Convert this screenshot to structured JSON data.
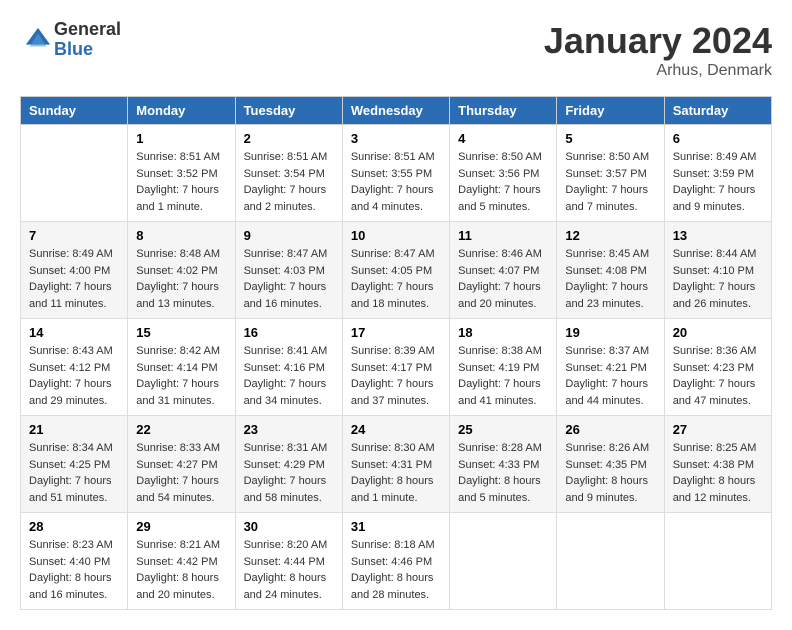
{
  "header": {
    "logo_general": "General",
    "logo_blue": "Blue",
    "month_title": "January 2024",
    "city": "Arhus, Denmark"
  },
  "days_of_week": [
    "Sunday",
    "Monday",
    "Tuesday",
    "Wednesday",
    "Thursday",
    "Friday",
    "Saturday"
  ],
  "weeks": [
    [
      {
        "day": "",
        "sunrise": "",
        "sunset": "",
        "daylight": ""
      },
      {
        "day": "1",
        "sunrise": "Sunrise: 8:51 AM",
        "sunset": "Sunset: 3:52 PM",
        "daylight": "Daylight: 7 hours and 1 minute."
      },
      {
        "day": "2",
        "sunrise": "Sunrise: 8:51 AM",
        "sunset": "Sunset: 3:54 PM",
        "daylight": "Daylight: 7 hours and 2 minutes."
      },
      {
        "day": "3",
        "sunrise": "Sunrise: 8:51 AM",
        "sunset": "Sunset: 3:55 PM",
        "daylight": "Daylight: 7 hours and 4 minutes."
      },
      {
        "day": "4",
        "sunrise": "Sunrise: 8:50 AM",
        "sunset": "Sunset: 3:56 PM",
        "daylight": "Daylight: 7 hours and 5 minutes."
      },
      {
        "day": "5",
        "sunrise": "Sunrise: 8:50 AM",
        "sunset": "Sunset: 3:57 PM",
        "daylight": "Daylight: 7 hours and 7 minutes."
      },
      {
        "day": "6",
        "sunrise": "Sunrise: 8:49 AM",
        "sunset": "Sunset: 3:59 PM",
        "daylight": "Daylight: 7 hours and 9 minutes."
      }
    ],
    [
      {
        "day": "7",
        "sunrise": "Sunrise: 8:49 AM",
        "sunset": "Sunset: 4:00 PM",
        "daylight": "Daylight: 7 hours and 11 minutes."
      },
      {
        "day": "8",
        "sunrise": "Sunrise: 8:48 AM",
        "sunset": "Sunset: 4:02 PM",
        "daylight": "Daylight: 7 hours and 13 minutes."
      },
      {
        "day": "9",
        "sunrise": "Sunrise: 8:47 AM",
        "sunset": "Sunset: 4:03 PM",
        "daylight": "Daylight: 7 hours and 16 minutes."
      },
      {
        "day": "10",
        "sunrise": "Sunrise: 8:47 AM",
        "sunset": "Sunset: 4:05 PM",
        "daylight": "Daylight: 7 hours and 18 minutes."
      },
      {
        "day": "11",
        "sunrise": "Sunrise: 8:46 AM",
        "sunset": "Sunset: 4:07 PM",
        "daylight": "Daylight: 7 hours and 20 minutes."
      },
      {
        "day": "12",
        "sunrise": "Sunrise: 8:45 AM",
        "sunset": "Sunset: 4:08 PM",
        "daylight": "Daylight: 7 hours and 23 minutes."
      },
      {
        "day": "13",
        "sunrise": "Sunrise: 8:44 AM",
        "sunset": "Sunset: 4:10 PM",
        "daylight": "Daylight: 7 hours and 26 minutes."
      }
    ],
    [
      {
        "day": "14",
        "sunrise": "Sunrise: 8:43 AM",
        "sunset": "Sunset: 4:12 PM",
        "daylight": "Daylight: 7 hours and 29 minutes."
      },
      {
        "day": "15",
        "sunrise": "Sunrise: 8:42 AM",
        "sunset": "Sunset: 4:14 PM",
        "daylight": "Daylight: 7 hours and 31 minutes."
      },
      {
        "day": "16",
        "sunrise": "Sunrise: 8:41 AM",
        "sunset": "Sunset: 4:16 PM",
        "daylight": "Daylight: 7 hours and 34 minutes."
      },
      {
        "day": "17",
        "sunrise": "Sunrise: 8:39 AM",
        "sunset": "Sunset: 4:17 PM",
        "daylight": "Daylight: 7 hours and 37 minutes."
      },
      {
        "day": "18",
        "sunrise": "Sunrise: 8:38 AM",
        "sunset": "Sunset: 4:19 PM",
        "daylight": "Daylight: 7 hours and 41 minutes."
      },
      {
        "day": "19",
        "sunrise": "Sunrise: 8:37 AM",
        "sunset": "Sunset: 4:21 PM",
        "daylight": "Daylight: 7 hours and 44 minutes."
      },
      {
        "day": "20",
        "sunrise": "Sunrise: 8:36 AM",
        "sunset": "Sunset: 4:23 PM",
        "daylight": "Daylight: 7 hours and 47 minutes."
      }
    ],
    [
      {
        "day": "21",
        "sunrise": "Sunrise: 8:34 AM",
        "sunset": "Sunset: 4:25 PM",
        "daylight": "Daylight: 7 hours and 51 minutes."
      },
      {
        "day": "22",
        "sunrise": "Sunrise: 8:33 AM",
        "sunset": "Sunset: 4:27 PM",
        "daylight": "Daylight: 7 hours and 54 minutes."
      },
      {
        "day": "23",
        "sunrise": "Sunrise: 8:31 AM",
        "sunset": "Sunset: 4:29 PM",
        "daylight": "Daylight: 7 hours and 58 minutes."
      },
      {
        "day": "24",
        "sunrise": "Sunrise: 8:30 AM",
        "sunset": "Sunset: 4:31 PM",
        "daylight": "Daylight: 8 hours and 1 minute."
      },
      {
        "day": "25",
        "sunrise": "Sunrise: 8:28 AM",
        "sunset": "Sunset: 4:33 PM",
        "daylight": "Daylight: 8 hours and 5 minutes."
      },
      {
        "day": "26",
        "sunrise": "Sunrise: 8:26 AM",
        "sunset": "Sunset: 4:35 PM",
        "daylight": "Daylight: 8 hours and 9 minutes."
      },
      {
        "day": "27",
        "sunrise": "Sunrise: 8:25 AM",
        "sunset": "Sunset: 4:38 PM",
        "daylight": "Daylight: 8 hours and 12 minutes."
      }
    ],
    [
      {
        "day": "28",
        "sunrise": "Sunrise: 8:23 AM",
        "sunset": "Sunset: 4:40 PM",
        "daylight": "Daylight: 8 hours and 16 minutes."
      },
      {
        "day": "29",
        "sunrise": "Sunrise: 8:21 AM",
        "sunset": "Sunset: 4:42 PM",
        "daylight": "Daylight: 8 hours and 20 minutes."
      },
      {
        "day": "30",
        "sunrise": "Sunrise: 8:20 AM",
        "sunset": "Sunset: 4:44 PM",
        "daylight": "Daylight: 8 hours and 24 minutes."
      },
      {
        "day": "31",
        "sunrise": "Sunrise: 8:18 AM",
        "sunset": "Sunset: 4:46 PM",
        "daylight": "Daylight: 8 hours and 28 minutes."
      },
      {
        "day": "",
        "sunrise": "",
        "sunset": "",
        "daylight": ""
      },
      {
        "day": "",
        "sunrise": "",
        "sunset": "",
        "daylight": ""
      },
      {
        "day": "",
        "sunrise": "",
        "sunset": "",
        "daylight": ""
      }
    ]
  ]
}
